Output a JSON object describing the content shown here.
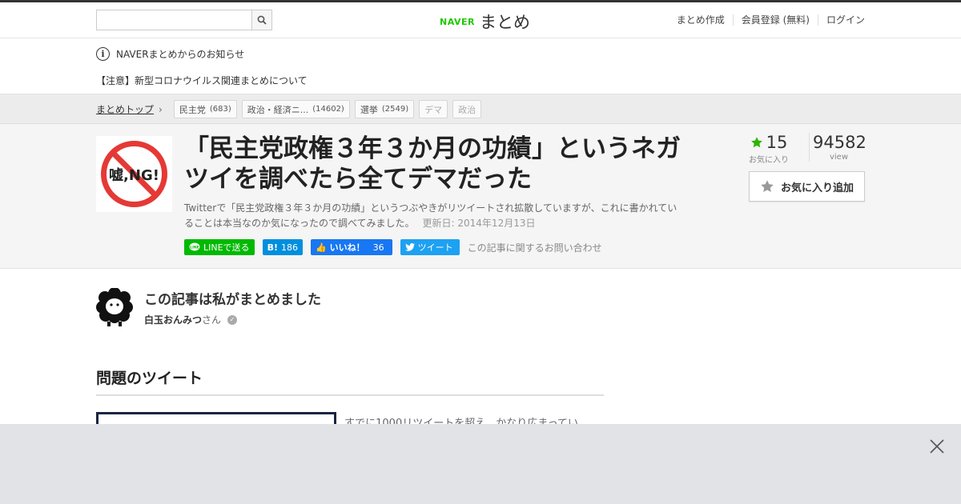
{
  "header": {
    "search": {
      "value": "",
      "placeholder": ""
    },
    "logo": {
      "brand": "NAVER",
      "name": "まとめ"
    },
    "nav": [
      "まとめ作成",
      "会員登録 (無料)",
      "ログイン"
    ]
  },
  "notice": {
    "heading": "NAVERまとめからのお知らせ",
    "item": "【注意】新型コロナウイルス関連まとめについて"
  },
  "breadcrumb": {
    "top": "まとめトップ",
    "tags": [
      {
        "label": "民主党",
        "count": "(683)"
      },
      {
        "label": "政治・経済ニ...",
        "count": "(14602)"
      },
      {
        "label": "選挙",
        "count": "(2549)"
      },
      {
        "label": "デマ",
        "count": ""
      },
      {
        "label": "政治",
        "count": ""
      }
    ]
  },
  "article": {
    "thumb_text": "嘘,NG!",
    "title": "「民主党政権３年３か月の功績」というネガツイを調べたら全てデマだった",
    "description": "Twitterで「民主党政権３年３か月の功績」というつぶやきがリツイートされ拡散していますが、これに書かれていることは本当なのか気になったので調べてみました。",
    "updated": "更新日: 2014年12月13日",
    "share": {
      "line": "LINEで送る",
      "hatena_count": "186",
      "fb_label": "いいね！",
      "fb_count": "36",
      "tweet": "ツイート"
    },
    "contact": "この記事に関するお問い合わせ",
    "favorites": {
      "count": "15",
      "label": "お気に入り"
    },
    "views": {
      "count": "94582",
      "label": "view"
    },
    "fav_button": "お気に入り追加"
  },
  "author": {
    "heading": "この記事は私がまとめました",
    "name": "白玉おんみつ",
    "suffix": "さん"
  },
  "section": {
    "title": "問題のツイート",
    "text": "すでに1000リツイートを超え、かなり広まってい"
  },
  "colors": {
    "naver_green": "#1ec800",
    "star_green": "#2db400",
    "line": "#00b900",
    "hatena": "#008fde",
    "facebook": "#1877f2",
    "twitter": "#1da1f2"
  }
}
